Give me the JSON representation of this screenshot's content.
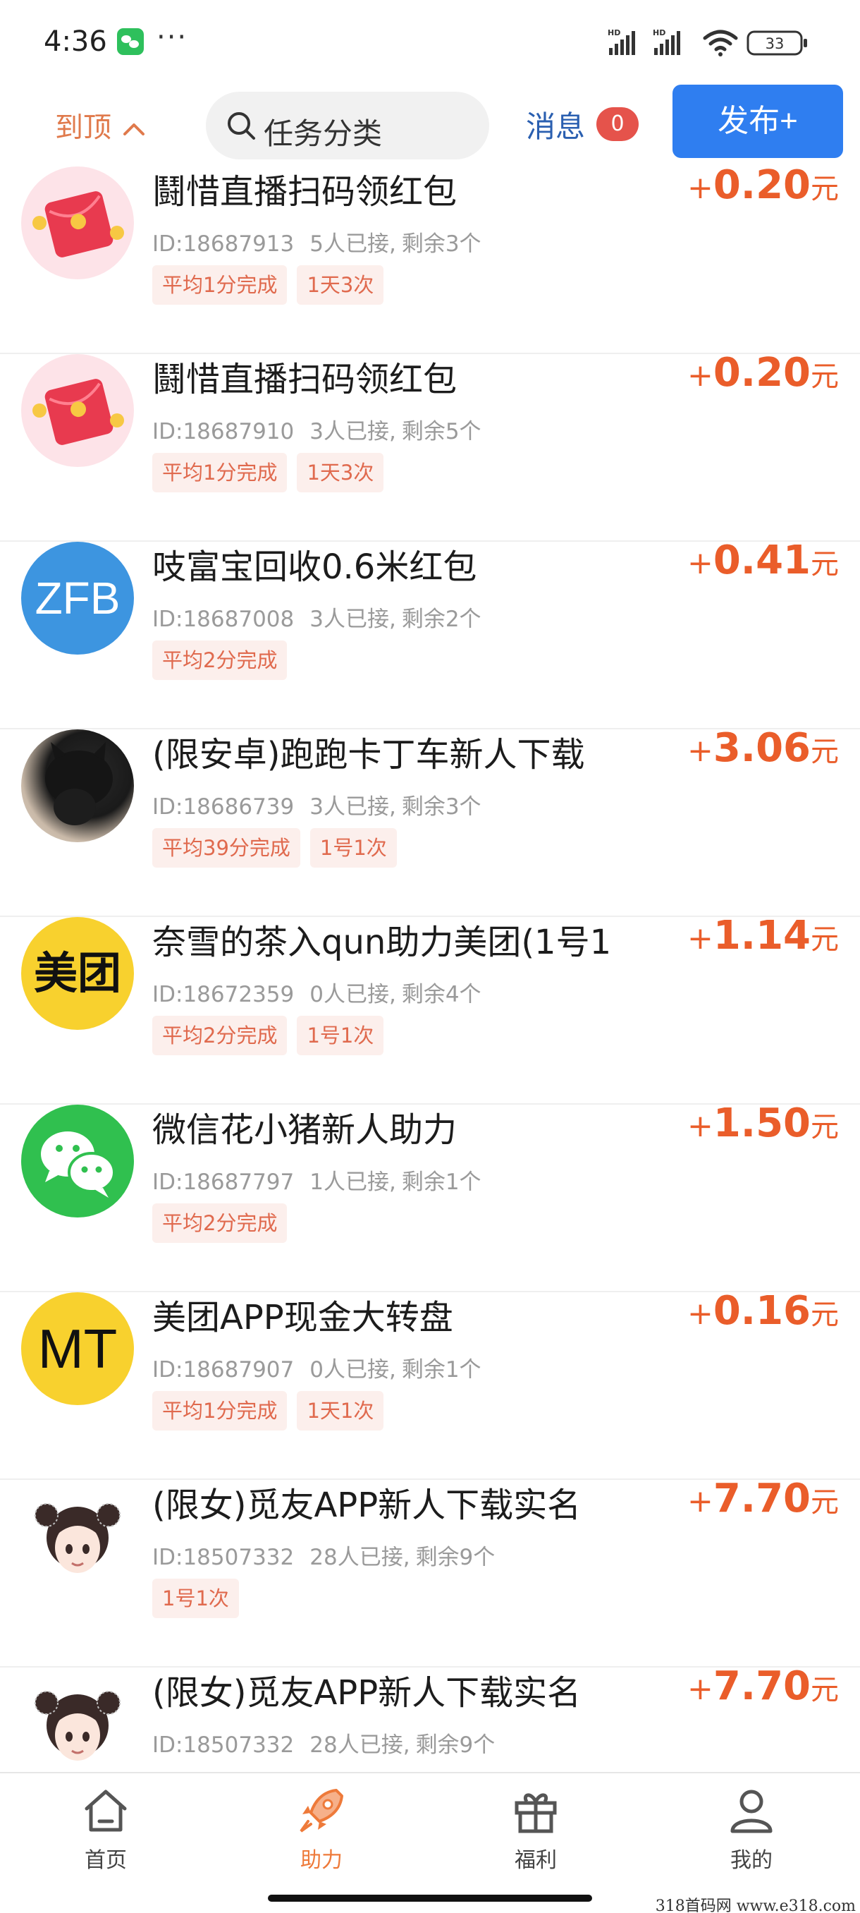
{
  "status_bar": {
    "time": "4:36",
    "dots": "···",
    "battery": "33",
    "icons": [
      "wechat-icon",
      "signal-hd-icon",
      "signal-hd-icon",
      "wifi-icon",
      "battery-icon"
    ]
  },
  "top_bar": {
    "to_top": "到顶",
    "search_placeholder": "任务分类",
    "messages_label": "消息",
    "messages_count": "0",
    "publish_label": "发布+"
  },
  "tasks": [
    {
      "title": "鬪惜直播扫码领红包",
      "id": "ID:18687913",
      "taken": "5人已接,",
      "remaining": "剩余3个",
      "tags": [
        "平均1分完成",
        "1天3次"
      ],
      "reward": "0.20",
      "avatar": "red-envelope-icon"
    },
    {
      "title": "鬪惜直播扫码领红包",
      "id": "ID:18687910",
      "taken": "3人已接,",
      "remaining": "剩余5个",
      "tags": [
        "平均1分完成",
        "1天3次"
      ],
      "reward": "0.20",
      "avatar": "red-envelope-icon"
    },
    {
      "title": "吱富宝回收0.6米红包",
      "id": "ID:18687008",
      "taken": "3人已接,",
      "remaining": "剩余2个",
      "tags": [
        "平均2分完成"
      ],
      "reward": "0.41",
      "avatar": "zfb-logo",
      "avatar_text": "ZFB"
    },
    {
      "title": "(限安卓)跑跑卡丁车新人下载",
      "id": "ID:18686739",
      "taken": "3人已接,",
      "remaining": "剩余3个",
      "tags": [
        "平均39分完成",
        "1号1次"
      ],
      "reward": "3.06",
      "avatar": "cat-photo"
    },
    {
      "title": "奈雪的茶入qun助力美团(1号1",
      "id": "ID:18672359",
      "taken": "0人已接,",
      "remaining": "剩余4个",
      "tags": [
        "平均2分完成",
        "1号1次"
      ],
      "reward": "1.14",
      "avatar": "meituan-logo",
      "avatar_text": "美团"
    },
    {
      "title": "微信花小猪新人助力",
      "id": "ID:18687797",
      "taken": "1人已接,",
      "remaining": "剩余1个",
      "tags": [
        "平均2分完成"
      ],
      "reward": "1.50",
      "avatar": "wechat-logo"
    },
    {
      "title": "美团APP现金大转盘",
      "id": "ID:18687907",
      "taken": "0人已接,",
      "remaining": "剩余1个",
      "tags": [
        "平均1分完成",
        "1天1次"
      ],
      "reward": "0.16",
      "avatar": "mt-logo",
      "avatar_text": "MT"
    },
    {
      "title": "(限女)觅友APP新人下载实名",
      "id": "ID:18507332",
      "taken": "28人已接,",
      "remaining": "剩余9个",
      "tags": [
        "1号1次"
      ],
      "reward": "7.70",
      "avatar": "girl-avatar"
    },
    {
      "title": "(限女)觅友APP新人下载实名",
      "id": "ID:18507332",
      "taken": "28人已接,",
      "remaining": "剩余9个",
      "tags": [],
      "reward": "7.70",
      "avatar": "girl-avatar"
    }
  ],
  "reward_plus": "+",
  "reward_unit": "元",
  "bottom_nav": [
    {
      "label": "首页",
      "icon": "home-icon",
      "active": false
    },
    {
      "label": "助力",
      "icon": "rocket-icon",
      "active": true
    },
    {
      "label": "福利",
      "icon": "gift-icon",
      "active": false
    },
    {
      "label": "我的",
      "icon": "user-icon",
      "active": false
    }
  ],
  "watermark": "318首码网 www.e318.com",
  "colors": {
    "accent_orange": "#ea5d2a",
    "publish_blue": "#2f7ef0",
    "msg_blue": "#2a5fb0",
    "badge_red": "#e5534b",
    "tag_bg": "#fcefec"
  }
}
